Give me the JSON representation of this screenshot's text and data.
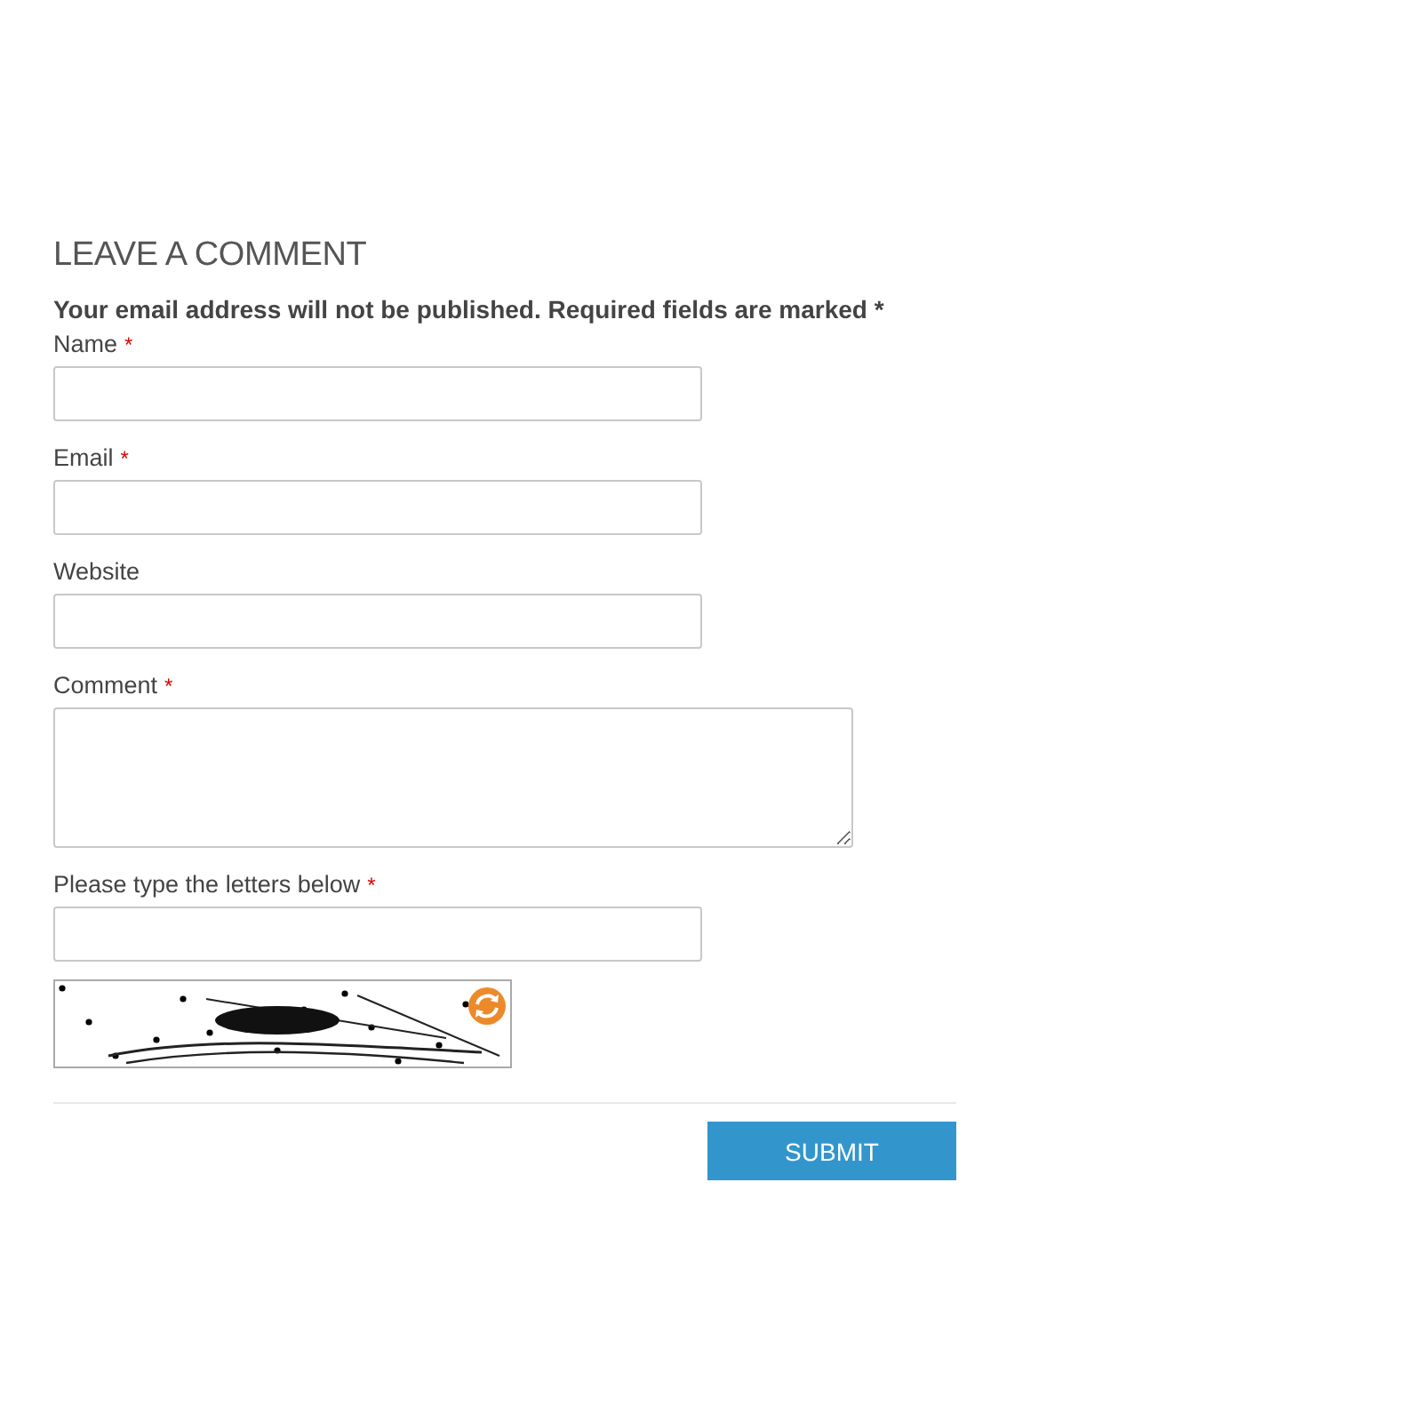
{
  "heading": "LEAVE A COMMENT",
  "notice": "Your email address will not be published. Required fields are marked *",
  "fields": [
    {
      "label": "Name",
      "required_mark": "*",
      "kind": "text"
    },
    {
      "label": "Email",
      "required_mark": "*",
      "kind": "text"
    },
    {
      "label": "Website",
      "kind": "text"
    },
    {
      "label": "Comment",
      "required_mark": "*",
      "kind": "textarea"
    },
    {
      "label": "Please type the letters below",
      "required_mark": "*",
      "kind": "text"
    }
  ],
  "submit": "SUBMIT"
}
